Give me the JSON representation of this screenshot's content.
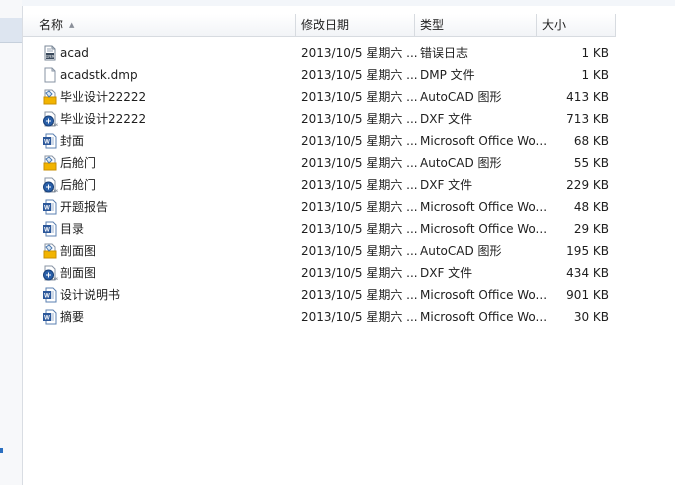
{
  "columns": {
    "name": "名称",
    "date": "修改日期",
    "type": "类型",
    "size": "大小"
  },
  "files": [
    {
      "name": "acad",
      "date": "2013/10/5 星期六 ...",
      "type": "错误日志",
      "size": "1 KB",
      "icon": "error-log-icon"
    },
    {
      "name": "acadstk.dmp",
      "date": "2013/10/5 星期六 ...",
      "type": "DMP 文件",
      "size": "1 KB",
      "icon": "blank-file-icon"
    },
    {
      "name": "毕业设计22222",
      "date": "2013/10/5 星期六 ...",
      "type": "AutoCAD 图形",
      "size": "413 KB",
      "icon": "autocad-dwg-icon"
    },
    {
      "name": "毕业设计22222",
      "date": "2013/10/5 星期六 ...",
      "type": "DXF 文件",
      "size": "713 KB",
      "icon": "dxf-file-icon"
    },
    {
      "name": "封面",
      "date": "2013/10/5 星期六 ...",
      "type": "Microsoft Office Wo...",
      "size": "68 KB",
      "icon": "word-doc-icon"
    },
    {
      "name": "后舱门",
      "date": "2013/10/5 星期六 ...",
      "type": "AutoCAD 图形",
      "size": "55 KB",
      "icon": "autocad-dwg-icon"
    },
    {
      "name": "后舱门",
      "date": "2013/10/5 星期六 ...",
      "type": "DXF 文件",
      "size": "229 KB",
      "icon": "dxf-file-icon"
    },
    {
      "name": "开题报告",
      "date": "2013/10/5 星期六 ...",
      "type": "Microsoft Office Wo...",
      "size": "48 KB",
      "icon": "word-doc-icon"
    },
    {
      "name": "目录",
      "date": "2013/10/5 星期六 ...",
      "type": "Microsoft Office Wo...",
      "size": "29 KB",
      "icon": "word-doc-icon"
    },
    {
      "name": "剖面图",
      "date": "2013/10/5 星期六 ...",
      "type": "AutoCAD 图形",
      "size": "195 KB",
      "icon": "autocad-dwg-icon"
    },
    {
      "name": "剖面图",
      "date": "2013/10/5 星期六 ...",
      "type": "DXF 文件",
      "size": "434 KB",
      "icon": "dxf-file-icon"
    },
    {
      "name": "设计说明书",
      "date": "2013/10/5 星期六 ...",
      "type": "Microsoft Office Wo...",
      "size": "901 KB",
      "icon": "word-doc-icon"
    },
    {
      "name": "摘要",
      "date": "2013/10/5 星期六 ...",
      "type": "Microsoft Office Wo...",
      "size": "30 KB",
      "icon": "word-doc-icon"
    }
  ]
}
